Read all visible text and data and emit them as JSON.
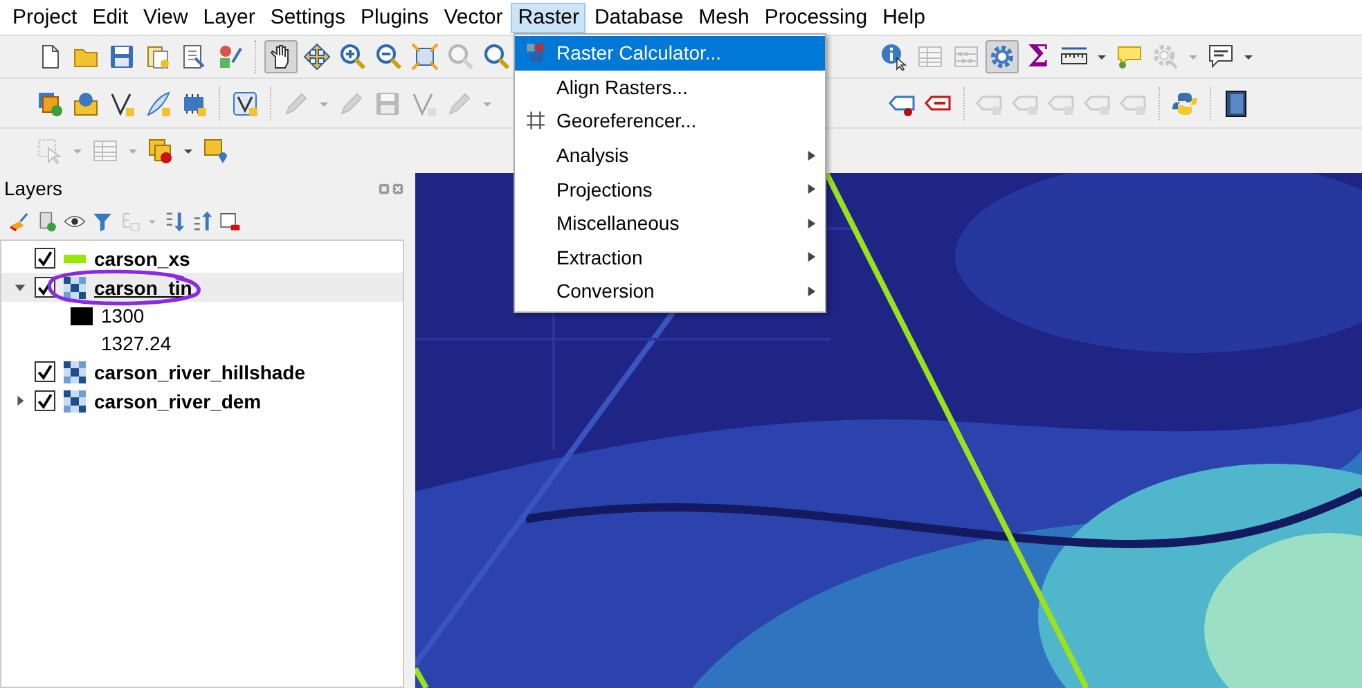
{
  "menubar": [
    {
      "label": "Project",
      "selected": false
    },
    {
      "label": "Edit",
      "selected": false
    },
    {
      "label": "View",
      "selected": false
    },
    {
      "label": "Layer",
      "selected": false
    },
    {
      "label": "Settings",
      "selected": false
    },
    {
      "label": "Plugins",
      "selected": false
    },
    {
      "label": "Vector",
      "selected": false
    },
    {
      "label": "Raster",
      "selected": true
    },
    {
      "label": "Database",
      "selected": false
    },
    {
      "label": "Mesh",
      "selected": false
    },
    {
      "label": "Processing",
      "selected": false
    },
    {
      "label": "Help",
      "selected": false
    }
  ],
  "raster_menu": [
    {
      "label": "Raster Calculator...",
      "kind": "calc",
      "submenu": false,
      "selected": true
    },
    {
      "label": "Align Rasters...",
      "kind": "plain",
      "submenu": false,
      "selected": false
    },
    {
      "label": "Georeferencer...",
      "kind": "grid",
      "submenu": false,
      "selected": false
    },
    {
      "label": "Analysis",
      "kind": "plain",
      "submenu": true,
      "selected": false
    },
    {
      "label": "Projections",
      "kind": "plain",
      "submenu": true,
      "selected": false
    },
    {
      "label": "Miscellaneous",
      "kind": "plain",
      "submenu": true,
      "selected": false
    },
    {
      "label": "Extraction",
      "kind": "plain",
      "submenu": true,
      "selected": false
    },
    {
      "label": "Conversion",
      "kind": "plain",
      "submenu": true,
      "selected": false
    }
  ],
  "toolbars": [
    {
      "segments": [
        [
          [
            {
              "kind": "page",
              "disabled": false,
              "on": false
            },
            {
              "kind": "folder",
              "disabled": false,
              "on": false
            },
            {
              "kind": "floppy",
              "disabled": false,
              "on": false
            },
            {
              "kind": "document",
              "disabled": false,
              "on": false
            },
            {
              "kind": "report",
              "disabled": false,
              "on": false
            },
            {
              "kind": "shapes",
              "disabled": false,
              "on": false
            }
          ],
          [
            {
              "kind": "hand",
              "disabled": false,
              "on": true
            },
            {
              "kind": "move",
              "disabled": false,
              "on": false
            },
            {
              "kind": "zoomin",
              "disabled": false,
              "on": false
            },
            {
              "kind": "zoomout",
              "disabled": false,
              "on": false
            },
            {
              "kind": "zoomfull",
              "disabled": false,
              "on": false
            },
            {
              "kind": "magnifier",
              "disabled": true,
              "on": false
            },
            {
              "kind": "magnifier",
              "disabled": false,
              "on": false
            }
          ]
        ],
        [
          [
            {
              "kind": "info",
              "disabled": false,
              "on": false
            },
            {
              "kind": "table",
              "disabled": true,
              "on": false
            },
            {
              "kind": "abacus",
              "disabled": true,
              "on": false
            },
            {
              "kind": "gear",
              "disabled": false,
              "on": true
            },
            {
              "kind": "glyph",
              "text": "Σ",
              "disabled": false,
              "on": false
            },
            {
              "kind": "ruler",
              "disabled": false,
              "on": false
            },
            {
              "kind": "caret",
              "disabled": false,
              "on": false
            },
            {
              "kind": "balloon",
              "disabled": false,
              "on": false
            },
            {
              "kind": "gearmag",
              "disabled": true,
              "on": false
            },
            {
              "kind": "caret",
              "disabled": true,
              "on": false
            },
            {
              "kind": "textballoon",
              "disabled": false,
              "on": false
            },
            {
              "kind": "caret",
              "disabled": false,
              "on": false
            }
          ]
        ]
      ]
    },
    {
      "segments": [
        [
          [
            {
              "kind": "layers",
              "disabled": false,
              "on": false
            },
            {
              "kind": "box",
              "disabled": false,
              "on": false
            },
            {
              "kind": "vertex",
              "disabled": false,
              "on": false
            },
            {
              "kind": "feather",
              "disabled": false,
              "on": false
            },
            {
              "kind": "chip",
              "disabled": false,
              "on": false
            }
          ],
          [
            {
              "kind": "vshield",
              "disabled": false,
              "on": false
            }
          ],
          [
            {
              "kind": "pencil",
              "disabled": true,
              "on": false
            },
            {
              "kind": "caret",
              "disabled": true,
              "on": false
            },
            {
              "kind": "pencil",
              "disabled": true,
              "on": false
            },
            {
              "kind": "floppy",
              "disabled": true,
              "on": false
            },
            {
              "kind": "vertex",
              "disabled": true,
              "on": false
            },
            {
              "kind": "pencil",
              "disabled": true,
              "on": false
            },
            {
              "kind": "caret",
              "disabled": true,
              "on": false
            }
          ]
        ],
        [
          [
            {
              "kind": "tag",
              "disabled": false,
              "on": false
            },
            {
              "kind": "redtag",
              "disabled": false,
              "on": false
            }
          ],
          [
            {
              "kind": "greytag",
              "disabled": true,
              "on": false
            },
            {
              "kind": "greytag",
              "disabled": true,
              "on": false
            },
            {
              "kind": "greytag",
              "disabled": true,
              "on": false
            },
            {
              "kind": "greytag",
              "disabled": true,
              "on": false
            },
            {
              "kind": "greytag",
              "disabled": true,
              "on": false
            }
          ],
          [
            {
              "kind": "python",
              "disabled": false,
              "on": false
            }
          ],
          [
            {
              "kind": "book",
              "disabled": false,
              "on": false
            }
          ]
        ]
      ]
    },
    {
      "segments": [
        [
          [
            {
              "kind": "select",
              "disabled": true,
              "on": false
            },
            {
              "kind": "caret",
              "disabled": true,
              "on": false
            },
            {
              "kind": "table",
              "disabled": true,
              "on": false
            },
            {
              "kind": "caret",
              "disabled": true,
              "on": false
            },
            {
              "kind": "squares",
              "disabled": false,
              "on": false
            },
            {
              "kind": "caret",
              "disabled": false,
              "on": false
            },
            {
              "kind": "pinsquare",
              "disabled": false,
              "on": false
            }
          ]
        ]
      ]
    }
  ],
  "layers": {
    "title": "Layers",
    "tools": [
      {
        "kind": "brush",
        "disabled": false
      },
      {
        "kind": "addgroup",
        "disabled": false
      },
      {
        "kind": "eye",
        "disabled": false
      },
      {
        "kind": "filter",
        "disabled": false
      },
      {
        "kind": "link",
        "disabled": true
      },
      {
        "kind": "caret",
        "disabled": true
      },
      {
        "kind": "expandall",
        "disabled": false
      },
      {
        "kind": "collapseall",
        "disabled": false
      },
      {
        "kind": "remove",
        "disabled": false
      }
    ],
    "tree": [
      {
        "name": "carson_xs",
        "kind": "line",
        "checked": true,
        "selected": false
      },
      {
        "name": "carson_tin",
        "kind": "raster",
        "checked": true,
        "expanded": true,
        "selected": true,
        "children": [
          {
            "label": "1300",
            "color": "#000000"
          },
          {
            "label": "1327.24"
          }
        ]
      },
      {
        "name": "carson_river_hillshade",
        "kind": "raster",
        "checked": true,
        "selected": false
      },
      {
        "name": "carson_river_dem",
        "kind": "raster",
        "checked": true,
        "expanded": false,
        "selected": false
      }
    ]
  }
}
